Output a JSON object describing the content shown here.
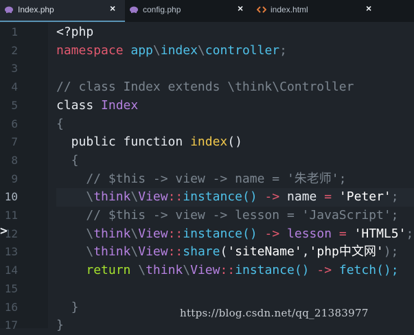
{
  "tabs": [
    {
      "label": "Index.php",
      "icon": "php-elephant-icon",
      "icon_color": "#9b78c8",
      "active": true
    },
    {
      "label": "config.php",
      "icon": "php-elephant-icon",
      "icon_color": "#9b78c8",
      "active": false
    },
    {
      "label": "index.html",
      "icon": "html-code-icon",
      "icon_color": "#e07b3c",
      "active": false
    }
  ],
  "close_glyph": "×",
  "colors": {
    "keyword": "#e2596f",
    "namespace": "#4fc1e9",
    "classname": "#b581e0",
    "function": "#f2c94c",
    "string": "#ffffff",
    "comment": "#7b858f",
    "operator": "#e2596f",
    "plain": "#e7ebf0",
    "green": "#a6e22e"
  },
  "lines": [
    {
      "n": "1",
      "tokens": [
        {
          "t": "<?php",
          "c": "plain"
        }
      ]
    },
    {
      "n": "2",
      "tokens": [
        {
          "t": "namespace ",
          "c": "keyword"
        },
        {
          "t": "app",
          "c": "namespace"
        },
        {
          "t": "\\",
          "c": "comment"
        },
        {
          "t": "index",
          "c": "namespace"
        },
        {
          "t": "\\",
          "c": "comment"
        },
        {
          "t": "controller",
          "c": "namespace"
        },
        {
          "t": ";",
          "c": "comment"
        }
      ]
    },
    {
      "n": "3",
      "tokens": []
    },
    {
      "n": "4",
      "tokens": [
        {
          "t": "// class Index extends \\think\\Controller",
          "c": "comment"
        }
      ]
    },
    {
      "n": "5",
      "tokens": [
        {
          "t": "class ",
          "c": "plain"
        },
        {
          "t": "Index",
          "c": "classname"
        }
      ]
    },
    {
      "n": "6",
      "tokens": [
        {
          "t": "{",
          "c": "comment"
        }
      ]
    },
    {
      "n": "7",
      "tokens": [
        {
          "t": "  public function ",
          "c": "plain"
        },
        {
          "t": "index",
          "c": "function"
        },
        {
          "t": "()",
          "c": "plain"
        }
      ]
    },
    {
      "n": "8",
      "tokens": [
        {
          "t": "  {",
          "c": "comment"
        }
      ]
    },
    {
      "n": "9",
      "tokens": [
        {
          "t": "    // $this -> view -> name = '朱老师';",
          "c": "comment"
        }
      ]
    },
    {
      "n": "10",
      "current": true,
      "tokens": [
        {
          "t": "    ",
          "c": "plain"
        },
        {
          "t": "\\",
          "c": "comment"
        },
        {
          "t": "think",
          "c": "classname"
        },
        {
          "t": "\\",
          "c": "comment"
        },
        {
          "t": "View",
          "c": "classname"
        },
        {
          "t": "::",
          "c": "operator"
        },
        {
          "t": "instance",
          "c": "namespace"
        },
        {
          "t": "() ",
          "c": "namespace"
        },
        {
          "t": "->",
          "c": "operator"
        },
        {
          "t": " name ",
          "c": "plain"
        },
        {
          "t": "=",
          "c": "operator"
        },
        {
          "t": " 'Peter'",
          "c": "string"
        },
        {
          "t": ";",
          "c": "comment"
        }
      ]
    },
    {
      "n": "11",
      "tokens": [
        {
          "t": "    // $this -> view -> lesson = 'JavaScript';",
          "c": "comment"
        }
      ]
    },
    {
      "n": "12",
      "tokens": [
        {
          "t": "    ",
          "c": "plain"
        },
        {
          "t": "\\",
          "c": "comment"
        },
        {
          "t": "think",
          "c": "classname"
        },
        {
          "t": "\\",
          "c": "comment"
        },
        {
          "t": "View",
          "c": "classname"
        },
        {
          "t": "::",
          "c": "operator"
        },
        {
          "t": "instance",
          "c": "namespace"
        },
        {
          "t": "() ",
          "c": "namespace"
        },
        {
          "t": "->",
          "c": "operator"
        },
        {
          "t": " lesson ",
          "c": "classname"
        },
        {
          "t": "=",
          "c": "operator"
        },
        {
          "t": " 'HTML5'",
          "c": "string"
        },
        {
          "t": ";",
          "c": "comment"
        }
      ]
    },
    {
      "n": "13",
      "tokens": [
        {
          "t": "    ",
          "c": "plain"
        },
        {
          "t": "\\",
          "c": "comment"
        },
        {
          "t": "think",
          "c": "classname"
        },
        {
          "t": "\\",
          "c": "comment"
        },
        {
          "t": "View",
          "c": "classname"
        },
        {
          "t": "::",
          "c": "operator"
        },
        {
          "t": "share",
          "c": "namespace"
        },
        {
          "t": "(",
          "c": "plain"
        },
        {
          "t": "'siteName'",
          "c": "string"
        },
        {
          "t": ",",
          "c": "plain"
        },
        {
          "t": "'php中文网'",
          "c": "string"
        },
        {
          "t": ");",
          "c": "comment"
        }
      ]
    },
    {
      "n": "14",
      "tokens": [
        {
          "t": "    ",
          "c": "plain"
        },
        {
          "t": "return ",
          "c": "green"
        },
        {
          "t": "\\",
          "c": "comment"
        },
        {
          "t": "think",
          "c": "classname"
        },
        {
          "t": "\\",
          "c": "comment"
        },
        {
          "t": "View",
          "c": "classname"
        },
        {
          "t": "::",
          "c": "operator"
        },
        {
          "t": "instance",
          "c": "namespace"
        },
        {
          "t": "() ",
          "c": "namespace"
        },
        {
          "t": "->",
          "c": "operator"
        },
        {
          "t": " fetch",
          "c": "namespace"
        },
        {
          "t": "();",
          "c": "namespace"
        }
      ]
    },
    {
      "n": "15",
      "tokens": []
    },
    {
      "n": "16",
      "tokens": [
        {
          "t": "  }",
          "c": "comment"
        }
      ]
    },
    {
      "n": "17",
      "tokens": [
        {
          "t": "}",
          "c": "comment"
        }
      ]
    }
  ],
  "fold_glyph": ">",
  "watermark": "https://blog.csdn.net/qq_21383977"
}
